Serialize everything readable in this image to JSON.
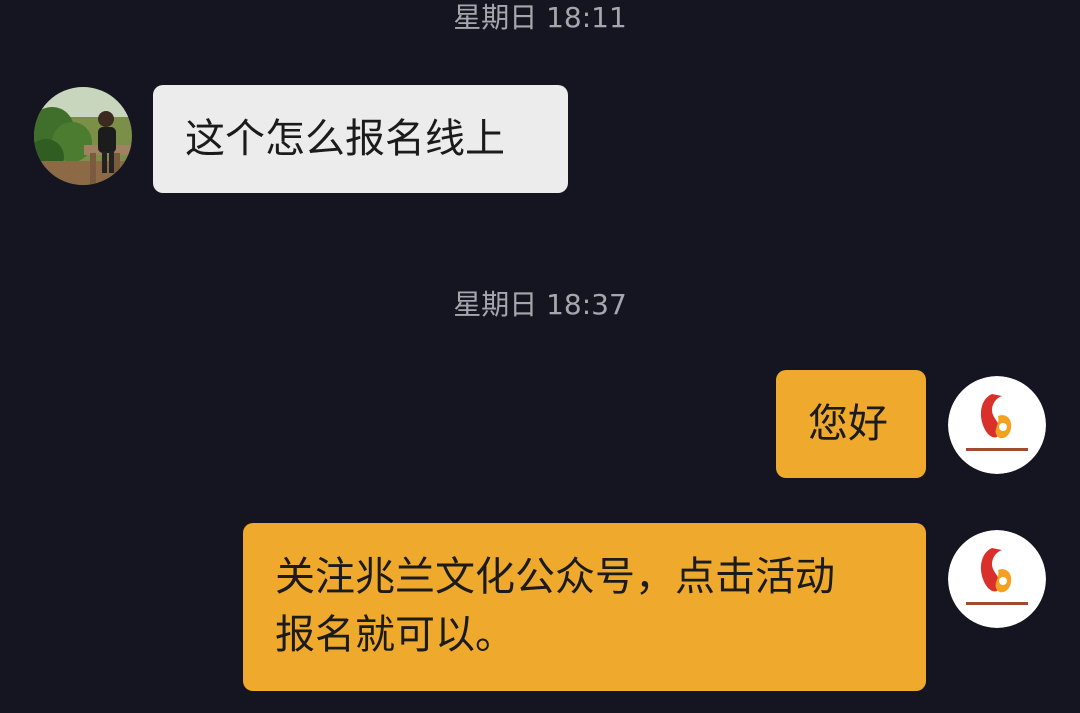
{
  "chat": {
    "messages": [
      {
        "timestamp": "星期日 18:11",
        "sender": "other",
        "text": "这个怎么报名线上"
      },
      {
        "timestamp": "星期日 18:37",
        "sender": "self",
        "text": "您好"
      },
      {
        "sender": "self",
        "text": "关注兆兰文化公众号，点击活动\n报名就可以。"
      }
    ]
  },
  "avatars": {
    "user": "user-photo-avatar",
    "org": "org-logo-avatar"
  },
  "colors": {
    "background": "#141521",
    "incoming_bubble": "#ececec",
    "outgoing_bubble": "#efa92c",
    "timestamp_text": "#a6a7ac",
    "message_text": "#1b1b1b",
    "logo_red": "#d9302b",
    "logo_orange": "#f3a11f"
  }
}
